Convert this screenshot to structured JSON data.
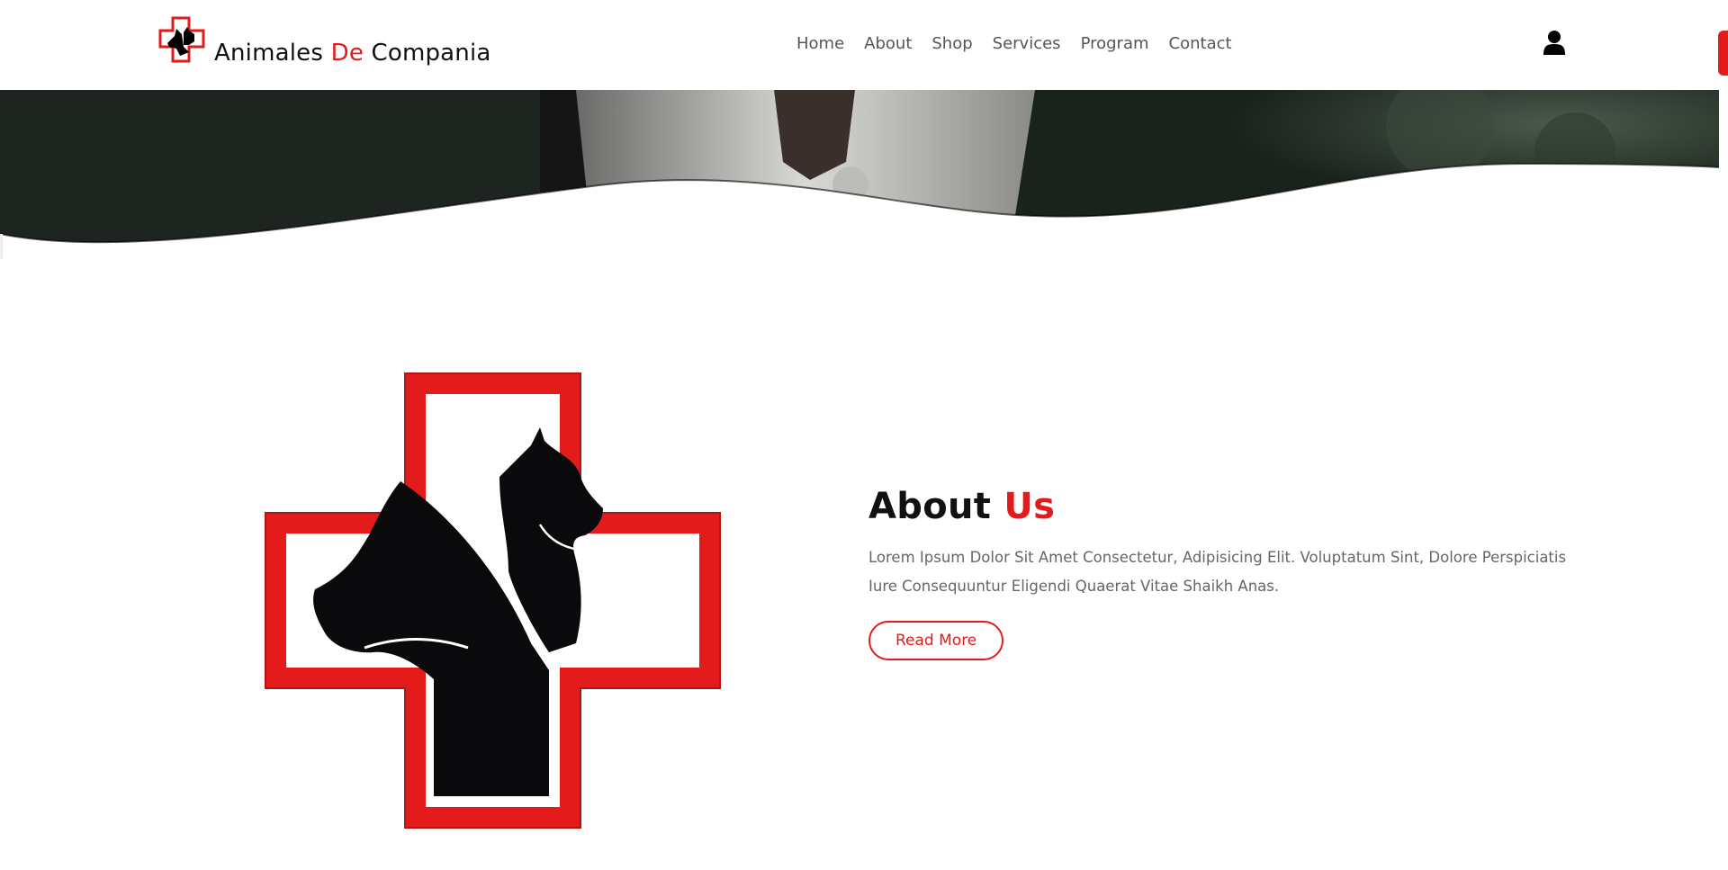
{
  "brand": {
    "name_part1": "Animales ",
    "name_accent": "De",
    "name_part2": " Compania",
    "accent_color": "#e31b1b"
  },
  "nav": {
    "items": [
      {
        "label": "Home"
      },
      {
        "label": "About"
      },
      {
        "label": "Shop"
      },
      {
        "label": "Services"
      },
      {
        "label": "Program"
      },
      {
        "label": "Contact"
      }
    ]
  },
  "header": {
    "user_icon": "user-icon"
  },
  "about": {
    "title_main": "About ",
    "title_accent": "Us",
    "description": "Lorem Ipsum Dolor Sit Amet Consectetur, Adipisicing Elit. Voluptatum Sint, Dolore Perspiciatis Iure Consequuntur Eligendi Quaerat Vitae Shaikh Anas.",
    "button_label": "Read More"
  }
}
